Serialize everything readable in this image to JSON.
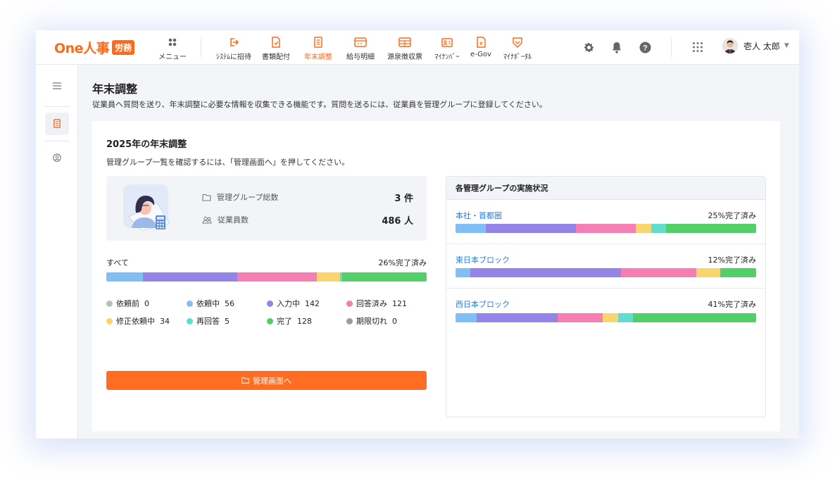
{
  "header": {
    "logo_text": "One人事",
    "logo_badge": "労務",
    "menu_label": "メニュー",
    "nav": [
      {
        "label": "ｼｽﾃﾑに招待",
        "icon": "invite-icon"
      },
      {
        "label": "書類配付",
        "icon": "document-icon"
      },
      {
        "label": "年末調整",
        "icon": "year-end-icon",
        "active": true
      },
      {
        "label": "給与明細",
        "icon": "payslip-icon"
      },
      {
        "label": "源泉徴収票",
        "icon": "withholding-icon"
      },
      {
        "label": "ﾏｲﾅﾝﾊﾞｰ",
        "icon": "mynumber-icon"
      },
      {
        "label": "e-Gov",
        "icon": "egov-icon"
      },
      {
        "label": "ﾏｲﾅﾎﾟｰﾀﾙ",
        "icon": "mynaportal-icon"
      }
    ],
    "user_name": "壱人 太郎",
    "accent": "#ff6a1a"
  },
  "page": {
    "title": "年末調整",
    "description": "従業員へ質問を送り、年末調整に必要な情報を収集できる機能です。質問を送るには、従業員を管理グループに登録してください。"
  },
  "card": {
    "title": "2025年の年末調整",
    "description": "管理グループ一覧を確認するには、「管理画面へ」を押してください。",
    "summary": {
      "groups_label": "管理グループ総数",
      "groups_value": "3 件",
      "employees_label": "従業員数",
      "employees_value": "486 人"
    },
    "all_label": "すべて",
    "all_pct": "26%完了済み",
    "all_bar": [
      70,
      179,
      151,
      44,
      5,
      160
    ],
    "legend": [
      {
        "label": "依頼前",
        "value": "0",
        "color": "#b9bcc6"
      },
      {
        "label": "依頼中",
        "value": "56",
        "color": "#7fbff5"
      },
      {
        "label": "入力中",
        "value": "142",
        "color": "#9584e8"
      },
      {
        "label": "回答済み",
        "value": "121",
        "color": "#f57fb3"
      },
      {
        "label": "修正依頼中",
        "value": "34",
        "color": "#f8d66d"
      },
      {
        "label": "再回答",
        "value": "5",
        "color": "#62dccf"
      },
      {
        "label": "完了",
        "value": "128",
        "color": "#53cf69"
      },
      {
        "label": "期限切れ",
        "value": "0",
        "color": "#9a9ca3"
      }
    ],
    "button_label": "管理画面へ"
  },
  "groups": {
    "title": "各管理グループの実施状況",
    "items": [
      {
        "name": "本社・首都圏",
        "pct": "25%完了済み",
        "bar": [
          10,
          30,
          20,
          5,
          5,
          30
        ]
      },
      {
        "name": "東日本ブロック",
        "pct": "12%完了済み",
        "bar": [
          5,
          50,
          25,
          8,
          0,
          12
        ]
      },
      {
        "name": "西日本ブロック",
        "pct": "41%完了済み",
        "bar": [
          7,
          27,
          15,
          5,
          5,
          41
        ]
      }
    ]
  },
  "seg_colors": [
    "#7fbff5",
    "#9584e8",
    "#f57fb3",
    "#f8d66d",
    "#62dccf",
    "#53cf69"
  ]
}
